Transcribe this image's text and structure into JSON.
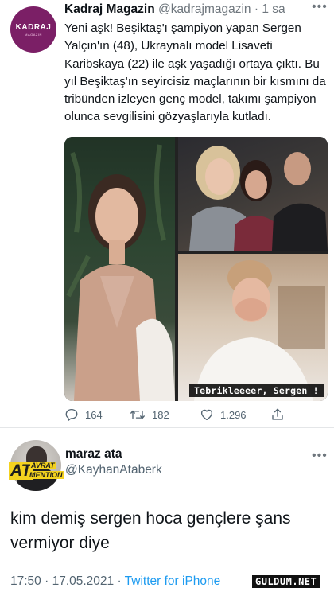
{
  "quoted_tweet": {
    "avatar_logo": "KADRAJ",
    "avatar_logo_sub": "MAGAZIN",
    "display_name": "Kadraj Magazin",
    "handle": "@kadrajmagazin",
    "separator": " · ",
    "time": "1 sa",
    "text": "Yeni aşk! Beşiktaş'ı şampiyon yapan Sergen Yalçın'ın (48), Ukraynalı model Lisaveti Karibskaya (22) ile aşk yaşadığı ortaya çıktı. Bu yıl Beşiktaş'ın seyircisiz maçlarının bir kısmını da tribünden izleyen genç model, takımı şampiyon olunca sevgilisini gözyaşlarıyla kutladı.",
    "image_caption": "Tebrikleeeer, Sergen !",
    "actions": {
      "replies": "164",
      "retweets": "182",
      "likes": "1.296"
    },
    "avatar_color": "#7b1f66"
  },
  "tweet": {
    "display_name": "maraz ata",
    "handle": "@KayhanAtaberk",
    "badge_main": "AT",
    "badge_word1": "AVRAT",
    "badge_word2": "MENTION",
    "text": "kim demiş sergen hoca gençlere şans vermiyor diye",
    "time": "17:50",
    "date": "17.05.2021",
    "meta_separator": " · ",
    "source": "Twitter for iPhone"
  },
  "watermark": "GULDUM.NET",
  "colors": {
    "link": "#1d9bf0",
    "secondary_text": "#536471"
  },
  "icons": [
    "more-icon",
    "reply-icon",
    "retweet-icon",
    "like-icon",
    "share-icon"
  ]
}
